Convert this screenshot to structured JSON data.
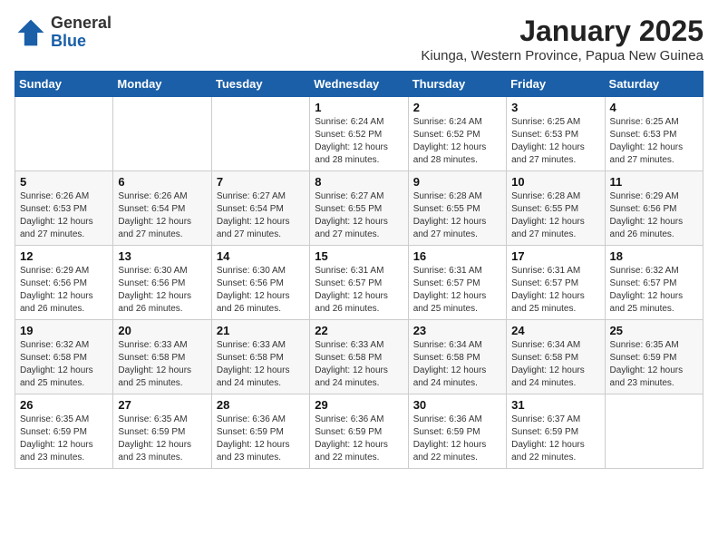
{
  "logo": {
    "general": "General",
    "blue": "Blue"
  },
  "title": "January 2025",
  "subtitle": "Kiunga, Western Province, Papua New Guinea",
  "days_of_week": [
    "Sunday",
    "Monday",
    "Tuesday",
    "Wednesday",
    "Thursday",
    "Friday",
    "Saturday"
  ],
  "weeks": [
    [
      {
        "day": "",
        "info": ""
      },
      {
        "day": "",
        "info": ""
      },
      {
        "day": "",
        "info": ""
      },
      {
        "day": "1",
        "info": "Sunrise: 6:24 AM\nSunset: 6:52 PM\nDaylight: 12 hours\nand 28 minutes."
      },
      {
        "day": "2",
        "info": "Sunrise: 6:24 AM\nSunset: 6:52 PM\nDaylight: 12 hours\nand 28 minutes."
      },
      {
        "day": "3",
        "info": "Sunrise: 6:25 AM\nSunset: 6:53 PM\nDaylight: 12 hours\nand 27 minutes."
      },
      {
        "day": "4",
        "info": "Sunrise: 6:25 AM\nSunset: 6:53 PM\nDaylight: 12 hours\nand 27 minutes."
      }
    ],
    [
      {
        "day": "5",
        "info": "Sunrise: 6:26 AM\nSunset: 6:53 PM\nDaylight: 12 hours\nand 27 minutes."
      },
      {
        "day": "6",
        "info": "Sunrise: 6:26 AM\nSunset: 6:54 PM\nDaylight: 12 hours\nand 27 minutes."
      },
      {
        "day": "7",
        "info": "Sunrise: 6:27 AM\nSunset: 6:54 PM\nDaylight: 12 hours\nand 27 minutes."
      },
      {
        "day": "8",
        "info": "Sunrise: 6:27 AM\nSunset: 6:55 PM\nDaylight: 12 hours\nand 27 minutes."
      },
      {
        "day": "9",
        "info": "Sunrise: 6:28 AM\nSunset: 6:55 PM\nDaylight: 12 hours\nand 27 minutes."
      },
      {
        "day": "10",
        "info": "Sunrise: 6:28 AM\nSunset: 6:55 PM\nDaylight: 12 hours\nand 27 minutes."
      },
      {
        "day": "11",
        "info": "Sunrise: 6:29 AM\nSunset: 6:56 PM\nDaylight: 12 hours\nand 26 minutes."
      }
    ],
    [
      {
        "day": "12",
        "info": "Sunrise: 6:29 AM\nSunset: 6:56 PM\nDaylight: 12 hours\nand 26 minutes."
      },
      {
        "day": "13",
        "info": "Sunrise: 6:30 AM\nSunset: 6:56 PM\nDaylight: 12 hours\nand 26 minutes."
      },
      {
        "day": "14",
        "info": "Sunrise: 6:30 AM\nSunset: 6:56 PM\nDaylight: 12 hours\nand 26 minutes."
      },
      {
        "day": "15",
        "info": "Sunrise: 6:31 AM\nSunset: 6:57 PM\nDaylight: 12 hours\nand 26 minutes."
      },
      {
        "day": "16",
        "info": "Sunrise: 6:31 AM\nSunset: 6:57 PM\nDaylight: 12 hours\nand 25 minutes."
      },
      {
        "day": "17",
        "info": "Sunrise: 6:31 AM\nSunset: 6:57 PM\nDaylight: 12 hours\nand 25 minutes."
      },
      {
        "day": "18",
        "info": "Sunrise: 6:32 AM\nSunset: 6:57 PM\nDaylight: 12 hours\nand 25 minutes."
      }
    ],
    [
      {
        "day": "19",
        "info": "Sunrise: 6:32 AM\nSunset: 6:58 PM\nDaylight: 12 hours\nand 25 minutes."
      },
      {
        "day": "20",
        "info": "Sunrise: 6:33 AM\nSunset: 6:58 PM\nDaylight: 12 hours\nand 25 minutes."
      },
      {
        "day": "21",
        "info": "Sunrise: 6:33 AM\nSunset: 6:58 PM\nDaylight: 12 hours\nand 24 minutes."
      },
      {
        "day": "22",
        "info": "Sunrise: 6:33 AM\nSunset: 6:58 PM\nDaylight: 12 hours\nand 24 minutes."
      },
      {
        "day": "23",
        "info": "Sunrise: 6:34 AM\nSunset: 6:58 PM\nDaylight: 12 hours\nand 24 minutes."
      },
      {
        "day": "24",
        "info": "Sunrise: 6:34 AM\nSunset: 6:58 PM\nDaylight: 12 hours\nand 24 minutes."
      },
      {
        "day": "25",
        "info": "Sunrise: 6:35 AM\nSunset: 6:59 PM\nDaylight: 12 hours\nand 23 minutes."
      }
    ],
    [
      {
        "day": "26",
        "info": "Sunrise: 6:35 AM\nSunset: 6:59 PM\nDaylight: 12 hours\nand 23 minutes."
      },
      {
        "day": "27",
        "info": "Sunrise: 6:35 AM\nSunset: 6:59 PM\nDaylight: 12 hours\nand 23 minutes."
      },
      {
        "day": "28",
        "info": "Sunrise: 6:36 AM\nSunset: 6:59 PM\nDaylight: 12 hours\nand 23 minutes."
      },
      {
        "day": "29",
        "info": "Sunrise: 6:36 AM\nSunset: 6:59 PM\nDaylight: 12 hours\nand 22 minutes."
      },
      {
        "day": "30",
        "info": "Sunrise: 6:36 AM\nSunset: 6:59 PM\nDaylight: 12 hours\nand 22 minutes."
      },
      {
        "day": "31",
        "info": "Sunrise: 6:37 AM\nSunset: 6:59 PM\nDaylight: 12 hours\nand 22 minutes."
      },
      {
        "day": "",
        "info": ""
      }
    ]
  ]
}
